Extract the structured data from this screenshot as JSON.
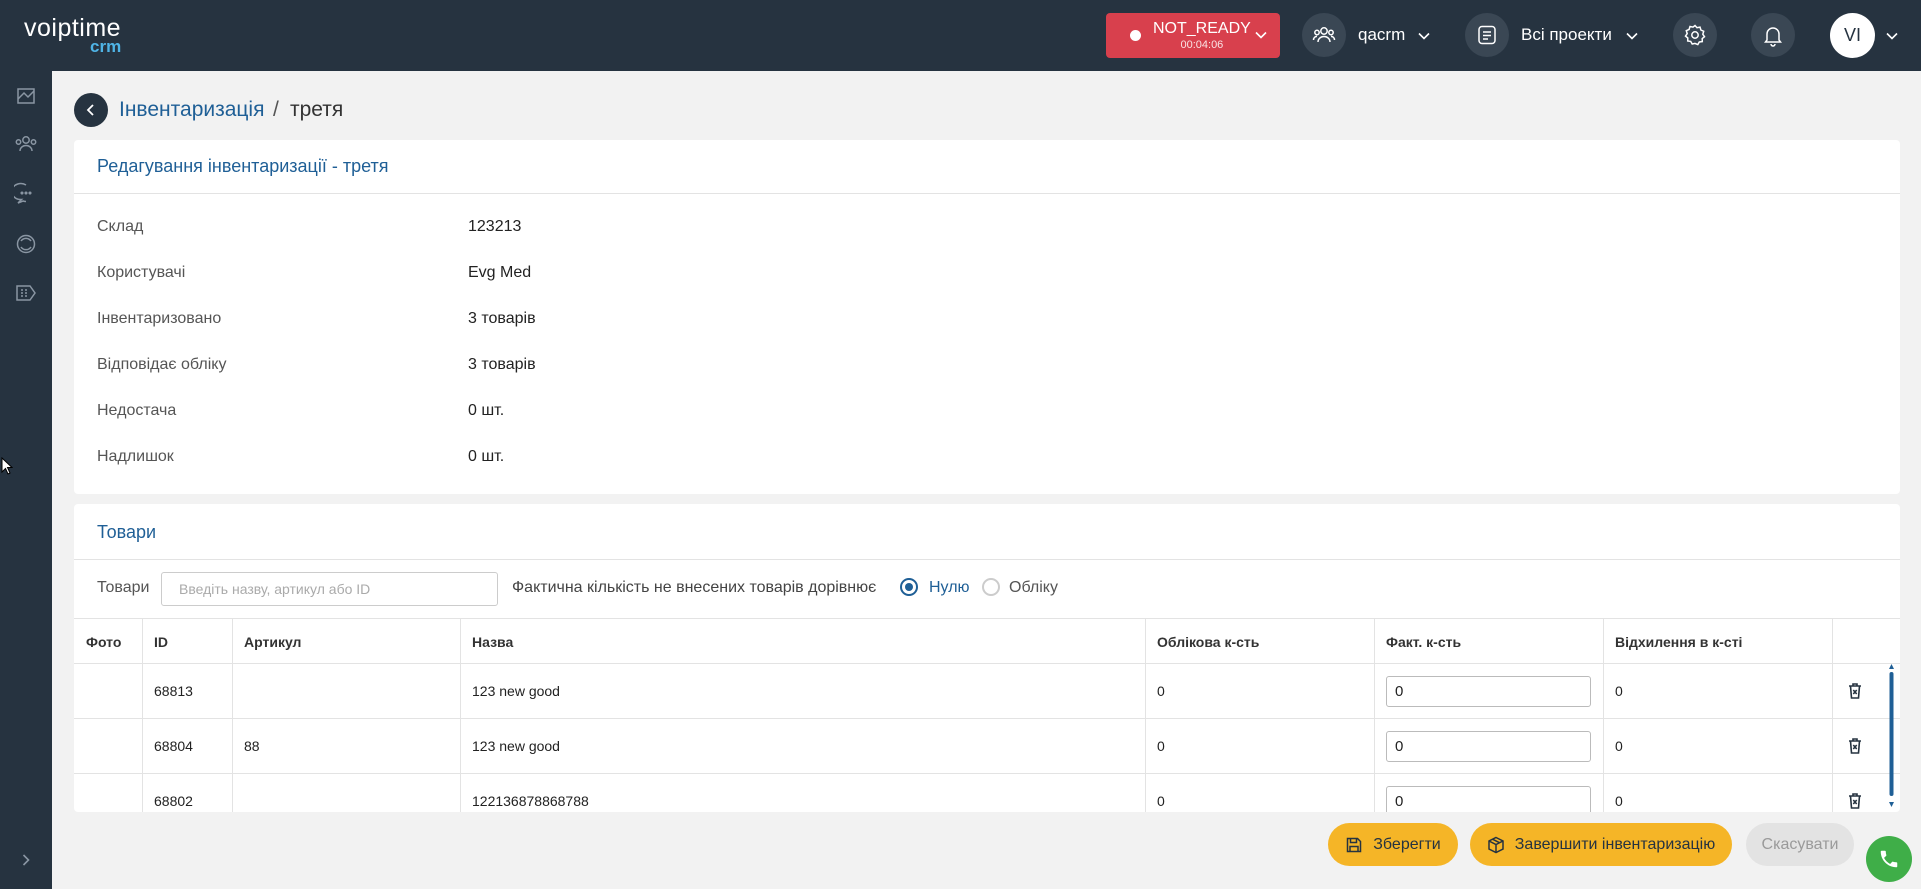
{
  "app": {
    "logo_main": "voiptime",
    "logo_sub": "crm"
  },
  "topbar": {
    "status": "NOT_READY",
    "status_timer": "00:04:06",
    "team": "qacrm",
    "projects": "Всі проекти",
    "avatar_initials": "VI",
    "status_color": "#d8404d"
  },
  "breadcrumb": {
    "parent": "Інвентаризація",
    "separator": "/",
    "current": "третя"
  },
  "info_card": {
    "title": "Редагування інвентаризації - третя",
    "rows": [
      {
        "label": "Склад",
        "value": "123213"
      },
      {
        "label": "Користувачі",
        "value": "Evg Med"
      },
      {
        "label": "Інвентаризовано",
        "value": "3 товарів"
      },
      {
        "label": "Відповідає обліку",
        "value": "3 товарів"
      },
      {
        "label": "Недостача",
        "value": "0 шт."
      },
      {
        "label": "Надлишок",
        "value": "0 шт."
      }
    ]
  },
  "goods_card": {
    "title": "Товари",
    "filter_label": "Товари",
    "search_placeholder": "Введіть назву, артикул або ID",
    "fact_label": "Фактична кількість не внесених товарів дорівнює",
    "radio_options": [
      {
        "label": "Нулю",
        "selected": true
      },
      {
        "label": "Обліку",
        "selected": false
      }
    ],
    "columns": [
      "Фото",
      "ID",
      "Артикул",
      "Назва",
      "Облікова к-сть",
      "Факт. к-сть",
      "Відхилення в к-сті"
    ],
    "rows": [
      {
        "photo": "",
        "id": "68813",
        "article": "",
        "name": "123 new good",
        "accounted": "0",
        "fact": "0",
        "deviation": "0"
      },
      {
        "photo": "",
        "id": "68804",
        "article": "88",
        "name": "123 new good",
        "accounted": "0",
        "fact": "0",
        "deviation": "0"
      },
      {
        "photo": "",
        "id": "68802",
        "article": "",
        "name": "122136878868788",
        "accounted": "0",
        "fact": "0",
        "deviation": "0"
      }
    ]
  },
  "actions": {
    "save": "Зберегти",
    "finish": "Завершити інвентаризацію",
    "cancel": "Скасувати"
  },
  "colors": {
    "accent": "#1f5f96",
    "topbar": "#263340",
    "action": "#f5b527",
    "call": "#3fae48"
  }
}
